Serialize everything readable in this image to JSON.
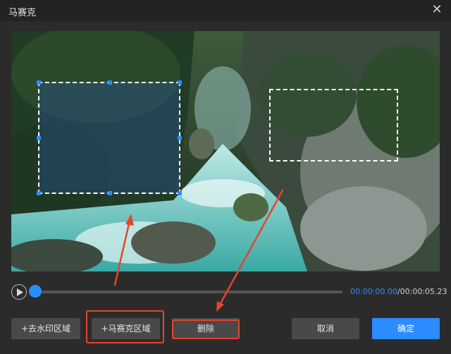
{
  "window": {
    "title": "马赛克"
  },
  "player": {
    "current_time": "00:00:00.00",
    "separator": "/",
    "total_time": "00:00:05.23",
    "progress": 0.0
  },
  "buttons": {
    "remove_watermark": "+去水印区域",
    "add_mosaic": "+马赛克区域",
    "delete": "删除",
    "cancel": "取消",
    "confirm": "确定"
  },
  "icons": {
    "close": "close-icon",
    "play": "play-icon"
  },
  "colors": {
    "accent": "#2a8cff",
    "annotation": "#e5452c"
  }
}
